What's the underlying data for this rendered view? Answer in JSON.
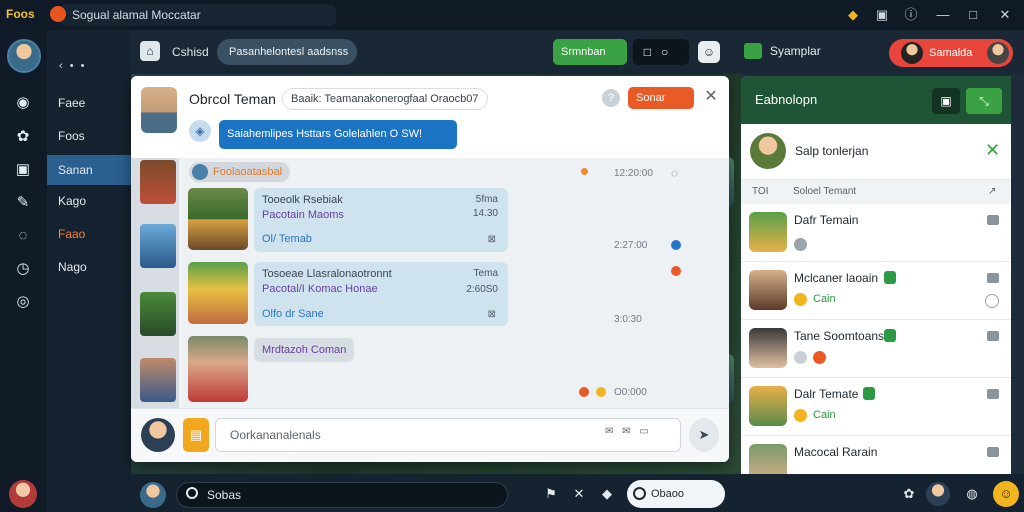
{
  "titlebar": {
    "logo": "Foos",
    "title": "Sogual alamal Moccatar",
    "controls": [
      "shield-icon",
      "camera-icon",
      "info-icon",
      "minimize-icon",
      "maximize-icon",
      "close-icon"
    ]
  },
  "rail": {
    "icons": [
      "camera-icon",
      "puzzle-icon",
      "square-icon",
      "pen-icon",
      "tag-icon",
      "clock-icon",
      "settings-icon"
    ]
  },
  "nav": {
    "dots": "‹ • •",
    "items": [
      {
        "label": "Faee"
      },
      {
        "label": "Foos"
      },
      {
        "label": "Sanan"
      },
      {
        "label": "Kago"
      },
      {
        "label": "Faao"
      },
      {
        "label": "Nago"
      }
    ]
  },
  "topbar": {
    "label": "Cshisd",
    "pill": "Pasanhelontesl aadsnss",
    "green_button": "Srmnban",
    "square_icons": "□○"
  },
  "chat": {
    "name": "Obrcol Teman",
    "subtitle": "Baaik: Teamanakonerogfaal Oraocb07",
    "action_button": "Sonar",
    "banner": "Saiahemlipes Hsttars Golelahlen O SW!",
    "tag": "Foolaoatasbal",
    "messages": [
      {
        "title": "Tooeolk Rsebiak",
        "meta": "5fma",
        "line": "Pacotain Maoms",
        "meta2": "14.30",
        "link": "Ol/ Temab",
        "time": "12:20:00"
      },
      {
        "title": "Tosoeae Llasralonaotronnt",
        "meta": "Tema",
        "line": "Pacotal/I Komac Honae",
        "meta2": "2:60S0",
        "link": "Olfo dr Sane",
        "time": "2:27:00"
      },
      {
        "line": "Mrdtazoh Coman",
        "time": "3:0:30",
        "time2": "O0:000"
      }
    ],
    "composer_placeholder": "Oorkananalenals",
    "composer_icons": "✉ ✉ ▭"
  },
  "right": {
    "top_label": "Syamplar",
    "user_pill": "Samalda",
    "panel_title": "Eabnolopn",
    "feature_name": "Salp tonlerjan",
    "col1": "TOI",
    "col2": "Soloel Temant",
    "items": [
      {
        "name": "Dafr Temain",
        "sub": ""
      },
      {
        "name": "Mclcaner laoain",
        "sub": "Cain"
      },
      {
        "name": "Tane Soomtoans",
        "sub": ""
      },
      {
        "name": "Dalr Temate",
        "sub": "Cain"
      },
      {
        "name": "Macocal Rarain",
        "sub": ""
      }
    ]
  },
  "bottombar": {
    "search": "Sobas",
    "pill": "Obaoo"
  },
  "colors": {
    "accent": "#2b5f8f",
    "green": "#3aa244",
    "orange": "#ea5a26",
    "chat_blue": "#1b73c4"
  }
}
